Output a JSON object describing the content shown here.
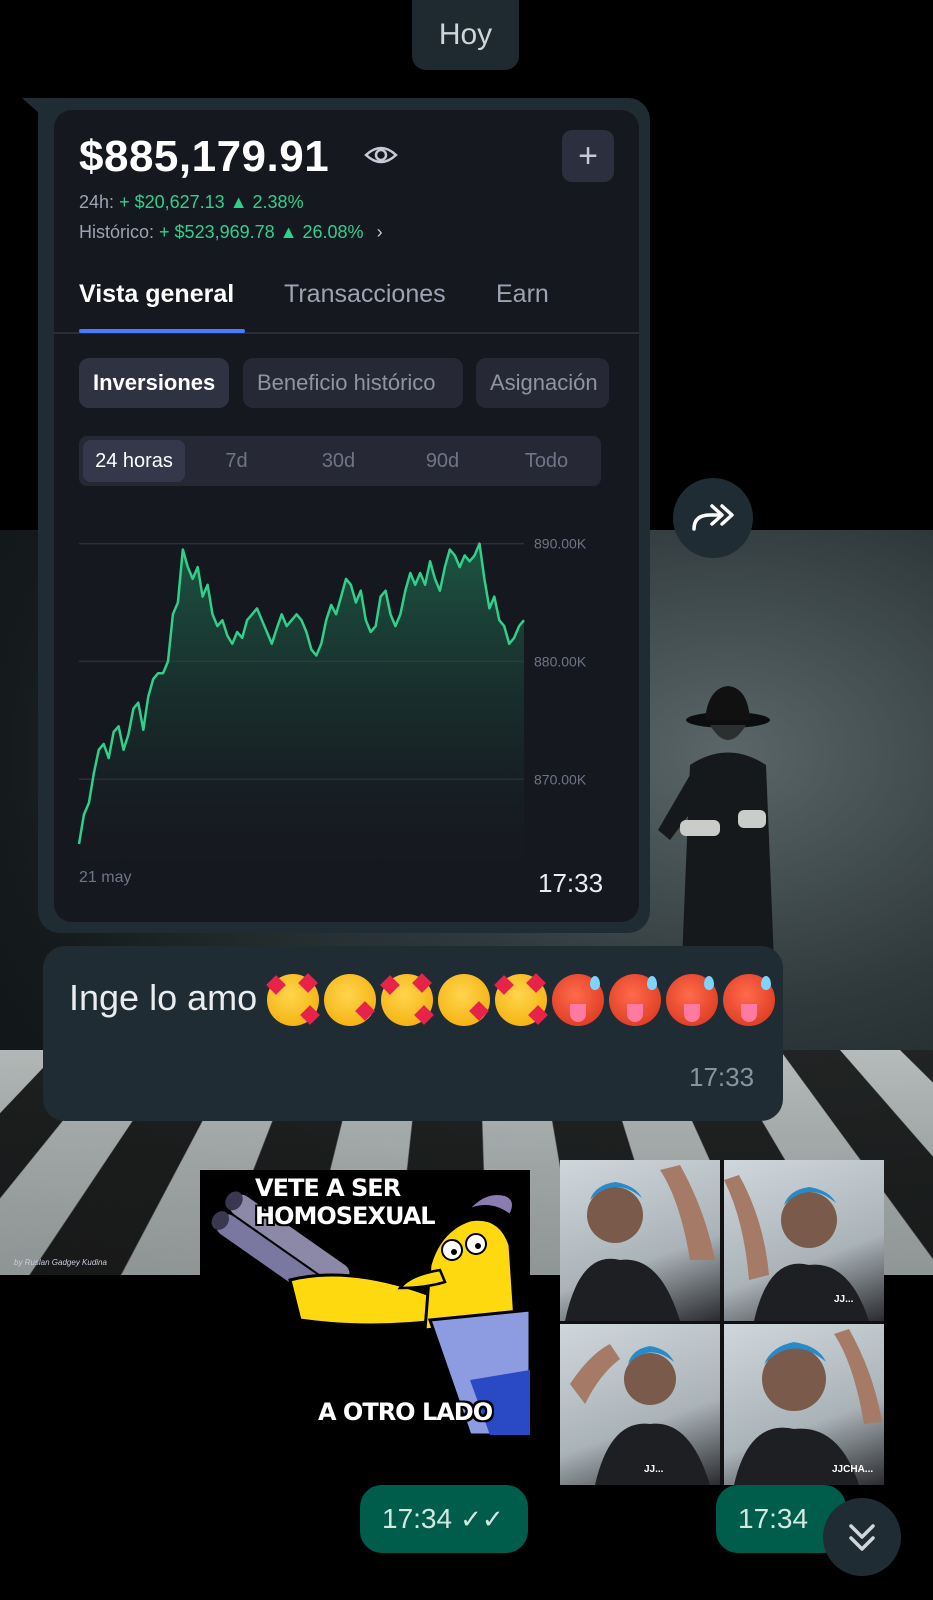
{
  "date_divider": "Hoy",
  "wallpaper": {
    "watermark": "by Ruslan Gadgey Kudina"
  },
  "portfolio": {
    "balance": "$885,179.91",
    "h24_label": "24h:",
    "h24_value": "+ $20,627.13",
    "h24_pct": "2.38%",
    "hist_label": "Histórico:",
    "hist_value": "+ $523,969.78",
    "hist_pct": "26.08%",
    "tabs": [
      "Vista general",
      "Transacciones",
      "Earn"
    ],
    "chips": [
      "Inversiones",
      "Beneficio histórico",
      "Asignación"
    ],
    "ranges": [
      "24 horas",
      "7d",
      "30d",
      "90d",
      "Todo"
    ],
    "accent_color": "#2fd08a",
    "tab_accent": "#4b79ff"
  },
  "chart_data": {
    "type": "area",
    "x_label_start": "21 may",
    "yticks": [
      "890.00K",
      "880.00K",
      "870.00K"
    ],
    "ylim": [
      864000,
      892000
    ],
    "series": [
      {
        "values": [
          864500,
          867000,
          868000,
          870500,
          872500,
          873000,
          871800,
          874000,
          874500,
          872500,
          873800,
          876000,
          876500,
          874200,
          877000,
          878500,
          879000,
          879000,
          880000,
          884000,
          885000,
          889500,
          888000,
          887000,
          888000,
          885500,
          886500,
          884000,
          883000,
          883500,
          882200,
          881500,
          882500,
          882000,
          883500,
          884000,
          884500,
          883500,
          882500,
          881500,
          882800,
          884000,
          883000,
          883500,
          884000,
          883500,
          882500,
          881000,
          880500,
          881500,
          883500,
          884800,
          884000,
          885500,
          887000,
          886500,
          885000,
          886000,
          883500,
          882500,
          883000,
          885500,
          886000,
          884000,
          883000,
          884000,
          886000,
          887500,
          886500,
          887500,
          886500,
          888500,
          887000,
          886000,
          888000,
          889500,
          889000,
          888000,
          889000,
          888500,
          889000,
          890000,
          887000,
          884500,
          885500,
          883500,
          883000,
          881500,
          882000,
          883000,
          883500
        ]
      }
    ]
  },
  "messages": {
    "screenshot_time": "17:33",
    "text_message": "Inge lo amo",
    "text_emojis": [
      "smiling-hearts",
      "kissing",
      "smiling-hearts",
      "kissing",
      "smiling-hearts",
      "hot-face",
      "hot-face",
      "hot-face",
      "hot-face"
    ],
    "text_time": "17:33",
    "meme_top": "VETE A SER HOMOSEXUAL",
    "meme_bottom": "A OTRO LADO",
    "meme_time": "17:34",
    "collage_time": "17:34",
    "collage_tags": [
      "JJ...",
      "JJ...",
      "JJCHA..."
    ]
  }
}
